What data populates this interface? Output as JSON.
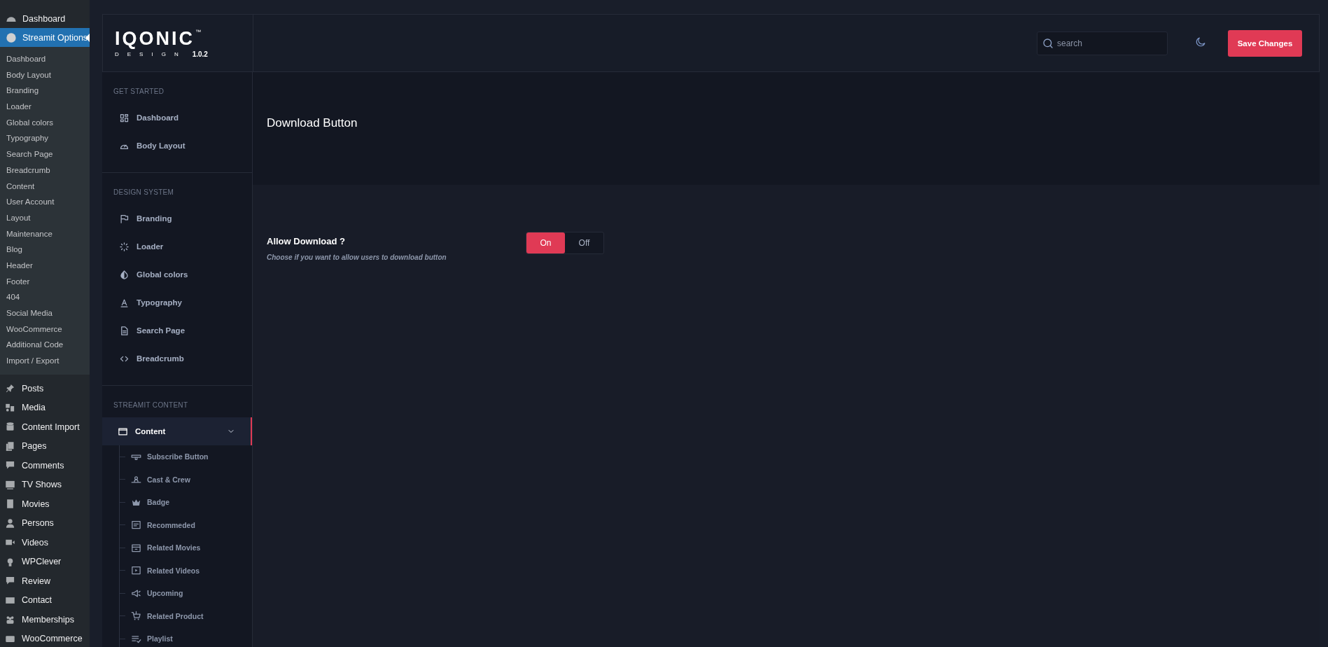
{
  "wp_menu": {
    "top": [
      {
        "label": "Dashboard",
        "selected": false
      },
      {
        "label": "Streamit Options",
        "selected": true
      }
    ],
    "submenu": [
      {
        "label": "Dashboard"
      },
      {
        "label": "Body Layout"
      },
      {
        "label": "Branding"
      },
      {
        "label": "Loader"
      },
      {
        "label": "Global colors"
      },
      {
        "label": "Typography"
      },
      {
        "label": "Search Page"
      },
      {
        "label": "Breadcrumb"
      },
      {
        "label": "Content"
      },
      {
        "label": "User Account"
      },
      {
        "label": "Layout"
      },
      {
        "label": "Maintenance"
      },
      {
        "label": "Blog"
      },
      {
        "label": "Header"
      },
      {
        "label": "Footer"
      },
      {
        "label": "404"
      },
      {
        "label": "Social Media"
      },
      {
        "label": "WooCommerce"
      },
      {
        "label": "Additional Code"
      },
      {
        "label": "Import / Export"
      }
    ],
    "items": [
      {
        "label": "Posts",
        "selected": false
      },
      {
        "label": "Media",
        "selected": false
      },
      {
        "label": "Content Import",
        "selected": false
      },
      {
        "label": "Pages",
        "selected": false
      },
      {
        "label": "Comments",
        "selected": false
      },
      {
        "label": "TV Shows",
        "selected": false
      },
      {
        "label": "Movies",
        "selected": false
      },
      {
        "label": "Persons",
        "selected": false
      },
      {
        "label": "Videos",
        "selected": false
      },
      {
        "label": "WPClever",
        "selected": false
      },
      {
        "label": "Review",
        "selected": false
      },
      {
        "label": "Contact",
        "selected": false
      },
      {
        "label": "Memberships",
        "selected": false
      },
      {
        "label": "WooCommerce",
        "selected": false
      }
    ]
  },
  "logo": {
    "name": "IQONIC",
    "mark": "™",
    "tagline": "DESIGN",
    "version": "1.0.2"
  },
  "header": {
    "search": {
      "placeholder": "search"
    },
    "save_button": "Save Changes"
  },
  "sidebar": {
    "sections": [
      {
        "title": "GET STARTED",
        "items": [
          {
            "label": "Dashboard",
            "selected": false
          },
          {
            "label": "Body Layout",
            "selected": false
          }
        ]
      },
      {
        "title": "DESIGN SYSTEM",
        "items": [
          {
            "label": "Branding",
            "selected": false
          },
          {
            "label": "Loader",
            "selected": false
          },
          {
            "label": "Global colors",
            "selected": false
          },
          {
            "label": "Typography",
            "selected": false
          },
          {
            "label": "Search Page",
            "selected": false
          },
          {
            "label": "Breadcrumb",
            "selected": false
          }
        ]
      },
      {
        "title": "STREAMIT CONTENT",
        "items": [
          {
            "label": "Content",
            "selected": true,
            "expanded": true,
            "children": [
              {
                "label": "Subscribe Button"
              },
              {
                "label": "Cast & Crew"
              },
              {
                "label": "Badge"
              },
              {
                "label": "Recommeded"
              },
              {
                "label": "Related Movies"
              },
              {
                "label": "Related Videos"
              },
              {
                "label": "Upcoming"
              },
              {
                "label": "Related Product"
              },
              {
                "label": "Playlist"
              }
            ]
          }
        ]
      }
    ]
  },
  "content": {
    "title": "Download Button",
    "fields": [
      {
        "label": "Allow Download ?",
        "description": "Choose if you want to allow users to download button",
        "options": [
          {
            "label": "On",
            "selected": true
          },
          {
            "label": "Off",
            "selected": false
          }
        ]
      }
    ]
  }
}
